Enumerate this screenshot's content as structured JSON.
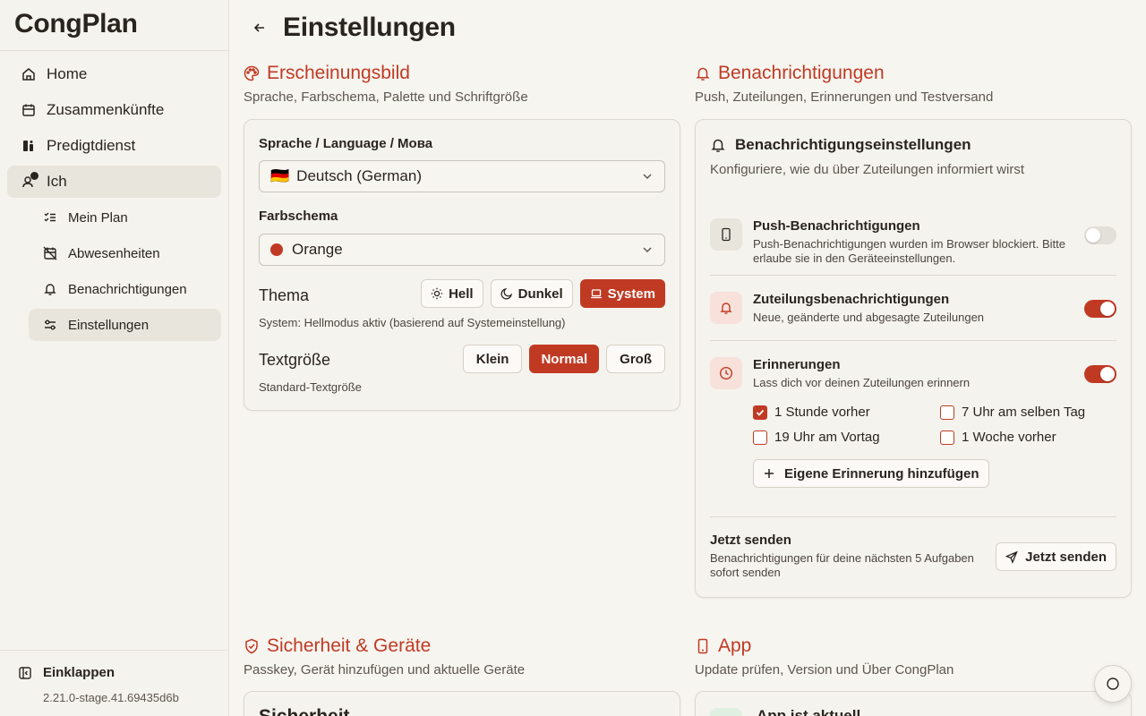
{
  "sidebar": {
    "brand": "CongPlan",
    "items": [
      {
        "label": "Home",
        "icon": "home-icon"
      },
      {
        "label": "Zusammenkünfte",
        "icon": "calendar-icon"
      },
      {
        "label": "Predigtdienst",
        "icon": "ministry-icon"
      },
      {
        "label": "Ich",
        "icon": "user-icon"
      }
    ],
    "subitems": [
      {
        "label": "Mein Plan",
        "icon": "checklist-icon"
      },
      {
        "label": "Abwesenheiten",
        "icon": "calendar-off-icon"
      },
      {
        "label": "Benachrichtigungen",
        "icon": "bell-icon"
      },
      {
        "label": "Einstellungen",
        "icon": "sliders-icon"
      }
    ],
    "collapse_label": "Einklappen",
    "version": "2.21.0-stage.41.69435d6b"
  },
  "header": {
    "title": "Einstellungen"
  },
  "appearance": {
    "title": "Erscheinungsbild",
    "subtitle": "Sprache, Farbschema, Palette und Schriftgröße",
    "language_label": "Sprache / Language / Мова",
    "language_flag": "🇩🇪",
    "language_value": "Deutsch (German)",
    "scheme_label": "Farbschema",
    "scheme_value": "Orange",
    "theme_label": "Thema",
    "theme_options": [
      "Hell",
      "Dunkel",
      "System"
    ],
    "theme_selected": "System",
    "theme_hint": "System: Hellmodus aktiv (basierend auf Systemeinstellung)",
    "textsize_label": "Textgröße",
    "textsize_options": [
      "Klein",
      "Normal",
      "Groß"
    ],
    "textsize_selected": "Normal",
    "textsize_hint": "Standard-Textgröße"
  },
  "notifications": {
    "title": "Benachrichtigungen",
    "subtitle": "Push, Zuteilungen, Erinnerungen und Testversand",
    "card_title": "Benachrichtigungseinstellungen",
    "card_subtitle": "Konfiguriere, wie du über Zuteilungen informiert wirst",
    "push_title": "Push-Benachrichtigungen",
    "push_desc_1": "Push-Benachrichtigungen wurden im Browser blockiert. Bitte",
    "push_desc_2": "erlaube sie in den Geräteeinstellungen.",
    "push_enabled": false,
    "assign_title": "Zuteilungsbenachrichtigungen",
    "assign_desc": "Neue, geänderte und abgesagte Zuteilungen",
    "assign_enabled": true,
    "reminder_title": "Erinnerungen",
    "reminder_desc": "Lass dich vor deinen Zuteilungen erinnern",
    "reminder_enabled": true,
    "reminder_options": [
      {
        "label": "1 Stunde vorher",
        "checked": true
      },
      {
        "label": "7 Uhr am selben Tag",
        "checked": false
      },
      {
        "label": "19 Uhr am Vortag",
        "checked": false
      },
      {
        "label": "1 Woche vorher",
        "checked": false
      }
    ],
    "add_reminder": "Eigene Erinnerung hinzufügen",
    "send_title": "Jetzt senden",
    "send_desc_1": "Benachrichtigungen für deine nächsten 5 Aufgaben",
    "send_desc_2": "sofort senden",
    "send_button": "Jetzt senden"
  },
  "security": {
    "title": "Sicherheit & Geräte",
    "subtitle": "Passkey, Gerät hinzufügen und aktuelle Geräte",
    "card_title": "Sicherheit"
  },
  "app": {
    "title": "App",
    "subtitle": "Update prüfen, Version und Über CongPlan",
    "card_title": "App ist aktuell"
  },
  "colors": {
    "accent": "#c03a23",
    "background": "#f7f5f0"
  }
}
